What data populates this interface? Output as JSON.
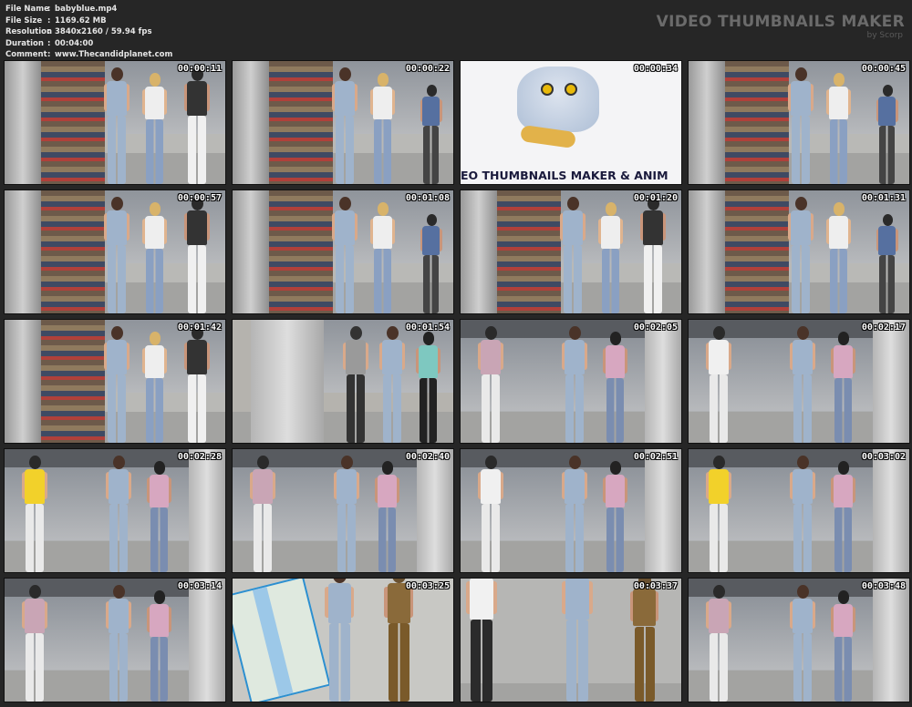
{
  "meta": {
    "rows": [
      {
        "key": "File Name",
        "value": "babyblue.mp4"
      },
      {
        "key": "File Size",
        "value": "1169.62 MB"
      },
      {
        "key": "Resolution",
        "value": "3840x2160 / 59.94 fps"
      },
      {
        "key": "Duration",
        "value": "00:04:00"
      },
      {
        "key": "Comment",
        "value": "www.Thecandidplanet.com"
      }
    ],
    "separator": ":"
  },
  "brand": {
    "title": "VIDEO THUMBNAILS MAKER",
    "subtitle": "by Scorp"
  },
  "logo_tile_text": "EO THUMBNAILS MAKER & ANIM",
  "thumbnails": [
    {
      "time": "00:00:11",
      "scene": "stall"
    },
    {
      "time": "00:00:22",
      "scene": "stall"
    },
    {
      "time": "00:00:34",
      "scene": "logo"
    },
    {
      "time": "00:00:45",
      "scene": "stall"
    },
    {
      "time": "00:00:57",
      "scene": "stall"
    },
    {
      "time": "00:01:08",
      "scene": "stall"
    },
    {
      "time": "00:01:20",
      "scene": "stall"
    },
    {
      "time": "00:01:31",
      "scene": "stall"
    },
    {
      "time": "00:01:42",
      "scene": "stall"
    },
    {
      "time": "00:01:54",
      "scene": "pillar"
    },
    {
      "time": "00:02:05",
      "scene": "street"
    },
    {
      "time": "00:02:17",
      "scene": "street"
    },
    {
      "time": "00:02:28",
      "scene": "street"
    },
    {
      "time": "00:02:40",
      "scene": "street"
    },
    {
      "time": "00:02:51",
      "scene": "street"
    },
    {
      "time": "00:03:02",
      "scene": "street"
    },
    {
      "time": "00:03:14",
      "scene": "street"
    },
    {
      "time": "00:03:25",
      "scene": "map"
    },
    {
      "time": "00:03:37",
      "scene": "closeup"
    },
    {
      "time": "00:03:48",
      "scene": "street"
    }
  ],
  "colors": {
    "background": "#262626",
    "meta_text": "#e6e6e6",
    "brand_text": "#6b6b6b",
    "outfit": "#9fb3cb"
  }
}
